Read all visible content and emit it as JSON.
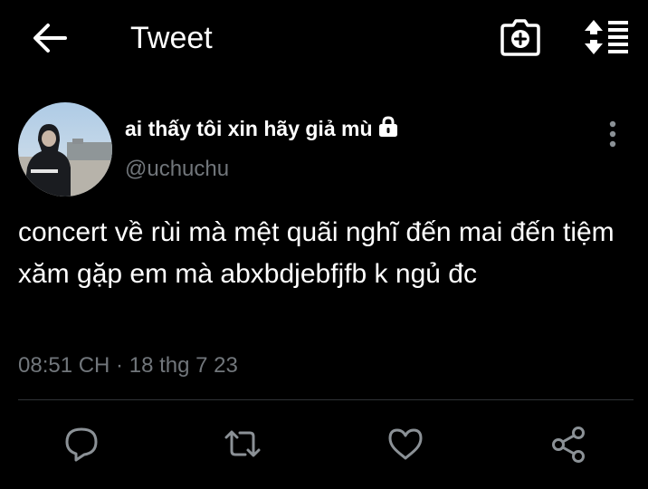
{
  "header": {
    "title": "Tweet",
    "icons": [
      "back-arrow-icon",
      "camera-plus-icon",
      "sort-list-icon"
    ]
  },
  "tweet": {
    "author": {
      "display_name": "ai thấy tôi xin hãy giả mù",
      "handle": "@uchuchu",
      "protected_icon": "lock-icon",
      "avatar": "profile-photo"
    },
    "text": "concert về rùi mà mệt quãi nghĩ đến mai đến tiệm xăm gặp em mà abxbdjebfjfb k ngủ đc",
    "timestamp": "08:51 CH · 18 thg 7 23"
  },
  "actions": [
    "reply-icon",
    "retweet-icon",
    "like-icon",
    "share-icon"
  ],
  "colors": {
    "background": "#000000",
    "primary_text": "#ffffff",
    "secondary_text": "#71767b",
    "divider": "#2f3336"
  }
}
